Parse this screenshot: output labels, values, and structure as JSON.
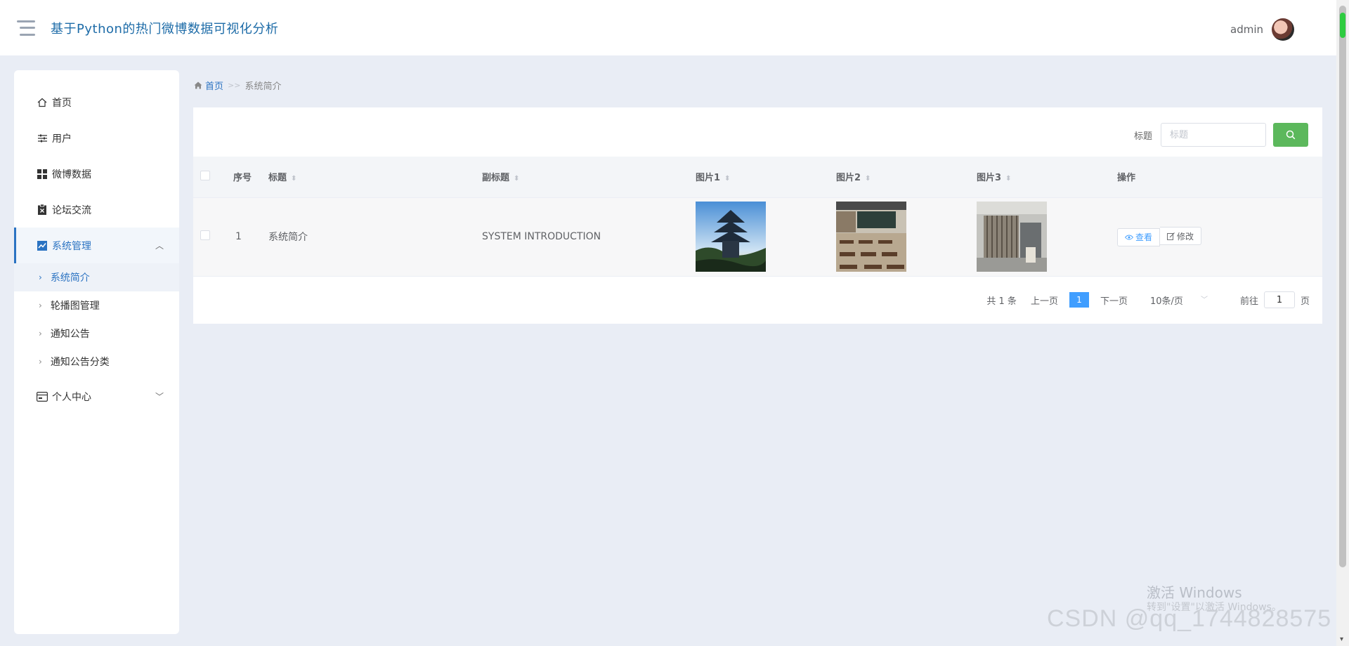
{
  "header": {
    "title": "基于Python的热门微博数据可视化分析",
    "username": "admin"
  },
  "sidebar": {
    "items": [
      {
        "label": "首页",
        "icon": "home-icon"
      },
      {
        "label": "用户",
        "icon": "sliders-icon"
      },
      {
        "label": "微博数据",
        "icon": "grid-icon"
      },
      {
        "label": "论坛交流",
        "icon": "clipboard-icon"
      },
      {
        "label": "系统管理",
        "icon": "chart-icon"
      },
      {
        "label": "个人中心",
        "icon": "card-icon"
      }
    ],
    "sub_items": [
      {
        "label": "系统简介"
      },
      {
        "label": "轮播图管理"
      },
      {
        "label": "通知公告"
      },
      {
        "label": "通知公告分类"
      }
    ]
  },
  "breadcrumb": {
    "home": "首页",
    "current": "系统简介"
  },
  "search": {
    "label": "标题",
    "placeholder": "标题"
  },
  "table": {
    "headers": {
      "index": "序号",
      "title": "标题",
      "subtitle": "副标题",
      "pic1": "图片1",
      "pic2": "图片2",
      "pic3": "图片3",
      "ops": "操作"
    },
    "rows": [
      {
        "index": "1",
        "title": "系统简介",
        "subtitle": "SYSTEM INTRODUCTION",
        "view": "查看",
        "edit": "修改"
      }
    ]
  },
  "pagination": {
    "total": "共 1 条",
    "prev": "上一页",
    "current": "1",
    "next": "下一页",
    "page_size": "10条/页",
    "goto_label": "前往",
    "goto_value": "1",
    "page_unit": "页"
  },
  "watermark": {
    "windows_title": "激活 Windows",
    "windows_sub": "转到\"设置\"以激活 Windows。",
    "csdn": "CSDN @qq_1744828575"
  },
  "colors": {
    "primary": "#409eff",
    "title": "#1e6ca8",
    "search_button": "#5cb85c",
    "background": "#e9edf5"
  }
}
